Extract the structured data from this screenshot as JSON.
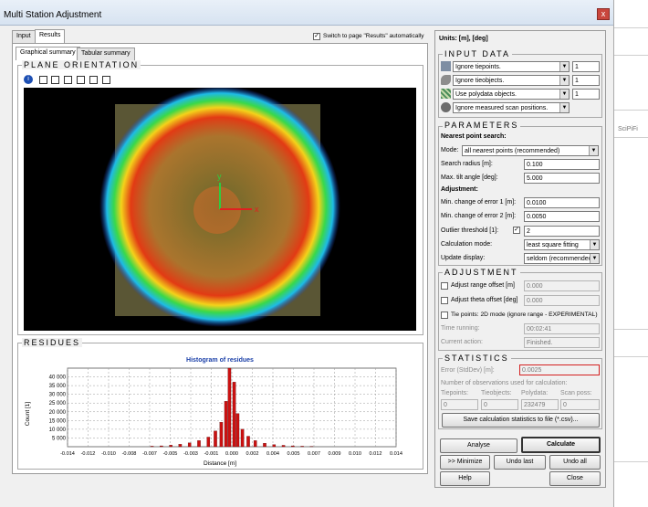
{
  "window": {
    "title": "Multi Station Adjustment",
    "close_glyph": "x"
  },
  "tabs": {
    "input": "Input",
    "results": "Results"
  },
  "switch_label": "Switch to page \"Results\" automatically",
  "subtabs": {
    "graphical": "Graphical summary",
    "tabular": "Tabular summary"
  },
  "plane": {
    "title": "PLANE ORIENTATION",
    "axis_x": "x",
    "axis_y": "y"
  },
  "residues": {
    "title": "RESIDUES",
    "chart_data": {
      "type": "bar",
      "title": "Histogram of residues",
      "xlabel": "Distance [m]",
      "ylabel": "Count [1]",
      "xlim": [
        -0.014,
        0.014
      ],
      "ylim": [
        0,
        45000
      ],
      "xticks": [
        "-0.014",
        "-0.012",
        "-0.010",
        "-0.008",
        "-0.007",
        "-0.005",
        "-0.003",
        "-0.001",
        "0.000",
        "0.002",
        "0.004",
        "0.005",
        "0.007",
        "0.009",
        "0.010",
        "0.012",
        "0.014"
      ],
      "yticks": [
        "5 000",
        "10 000",
        "15 000",
        "20 000",
        "25 000",
        "30 000",
        "35 000",
        "40 000"
      ],
      "bins": [
        -0.0068,
        -0.006,
        -0.0052,
        -0.0044,
        -0.0036,
        -0.0028,
        -0.002,
        -0.0014,
        -0.0009,
        -0.0005,
        -0.0002,
        0.0002,
        0.0005,
        0.0009,
        0.0014,
        0.002,
        0.0028,
        0.0036,
        0.0044,
        0.0052,
        0.006,
        0.0068
      ],
      "values": [
        300,
        500,
        900,
        1400,
        2200,
        3500,
        5500,
        9000,
        14000,
        26000,
        45000,
        37000,
        19000,
        10000,
        6000,
        3500,
        2000,
        1200,
        800,
        500,
        300,
        200
      ]
    }
  },
  "units": "Units: [m], [deg]",
  "input_data": {
    "title": "INPUT DATA",
    "rows": [
      {
        "icon": "tiepoint-icon",
        "value": "Ignore tiepoints.",
        "count": "1"
      },
      {
        "icon": "tieobject-icon",
        "value": "Ignore tieobjects.",
        "count": "1"
      },
      {
        "icon": "polydata-icon",
        "value": "Use polydata objects.",
        "count": "1"
      },
      {
        "icon": "scanpos-icon",
        "value": "Ignore measured scan positions."
      }
    ]
  },
  "parameters": {
    "title": "PARAMETERS",
    "nearest_heading": "Nearest point search:",
    "mode_label": "Mode:",
    "mode_value": "all nearest points (recommended)",
    "search_radius_label": "Search radius [m]:",
    "search_radius": "0.100",
    "tilt_label": "Max. tilt angle [deg]:",
    "tilt": "5.000",
    "adjustment_heading": "Adjustment:",
    "err1_label": "Min. change of error 1 [m]:",
    "err1": "0.0100",
    "err2_label": "Min. change of error 2 [m]:",
    "err2": "0.0050",
    "outlier_label": "Outlier threshold [1]:",
    "outlier_check": "✓",
    "outlier": "2",
    "calc_mode_label": "Calculation mode:",
    "calc_mode": "least square fitting",
    "update_label": "Update display:",
    "update": "seldom (recommended)"
  },
  "adjustment": {
    "title": "ADJUSTMENT",
    "range_label": "Adjust range offset [m]",
    "range": "0.000",
    "theta_label": "Adjust theta offset [deg]",
    "theta": "0.000",
    "tie2d_label": "Tie points: 2D mode (ignore range - EXPERIMENTAL)",
    "time_label": "Time running:",
    "time": "00:02:41",
    "action_label": "Current action:",
    "action": "Finished."
  },
  "statistics": {
    "title": "STATISTICS",
    "error_label": "Error (StdDev) [m]:",
    "error": "0.0025",
    "obs_heading": "Number of observations used for calculation:",
    "cols": [
      "Tiepoints:",
      "Tieobjects:",
      "Polydata:",
      "Scan poss:"
    ],
    "vals": [
      "0",
      "0",
      "232479",
      "0"
    ],
    "save_button": "Save calculation statistics to file (*.csv)..."
  },
  "buttons": {
    "analyse": "Analyse",
    "calculate": "Calculate",
    "minimize": ">> Minimize",
    "undo_last": "Undo last",
    "undo_all": "Undo all",
    "help": "Help",
    "close": "Close"
  },
  "background_window": {
    "label": "SciPiFi"
  },
  "colors": {
    "plane_bg": "#000000",
    "plane_square": "#5a5635",
    "hist_bar": "#cc1111",
    "accent_red": "#d32020"
  }
}
